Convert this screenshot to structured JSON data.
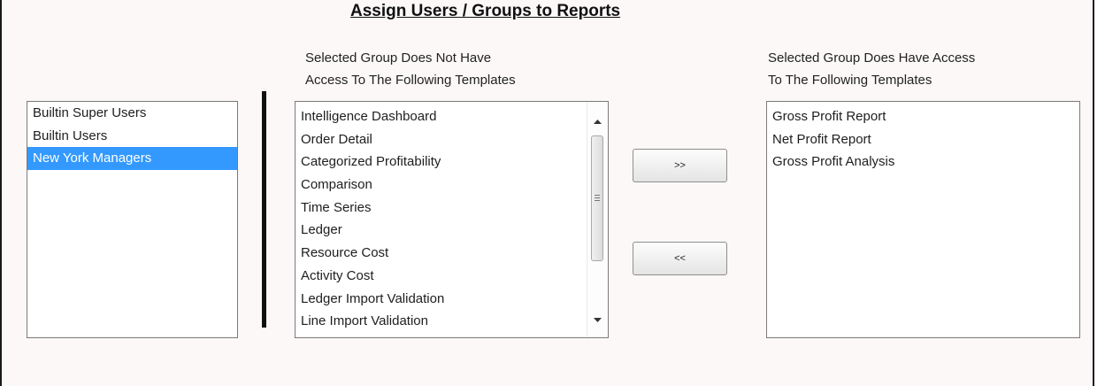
{
  "title": "Assign Users / Groups to Reports",
  "groups": {
    "items": [
      "Builtin Super Users",
      "Builtin Users",
      "New York Managers"
    ],
    "selected_index": 2
  },
  "no_access": {
    "caption_line1": "Selected Group Does Not Have",
    "caption_line2": "Access To The Following Templates",
    "items": [
      "Intelligence Dashboard",
      "Order Detail",
      "Categorized Profitability",
      "Comparison",
      "Time Series",
      "Ledger",
      "Resource Cost",
      "Activity Cost",
      "Ledger Import Validation",
      "Line Import Validation"
    ]
  },
  "has_access": {
    "caption_line1": "Selected Group Does Have Access",
    "caption_line2": "To The Following Templates",
    "items": [
      "Gross Profit Report",
      "Net Profit Report",
      "Gross Profit Analysis"
    ]
  },
  "buttons": {
    "add_label": ">>",
    "remove_label": "<<"
  },
  "colors": {
    "selection": "#3399ff",
    "panel_bg": "#fcf8f8"
  },
  "icons": {
    "scroll_up": "scroll-up-arrow-icon",
    "scroll_down": "scroll-down-arrow-icon",
    "scroll_grip": "scroll-grip-icon"
  }
}
